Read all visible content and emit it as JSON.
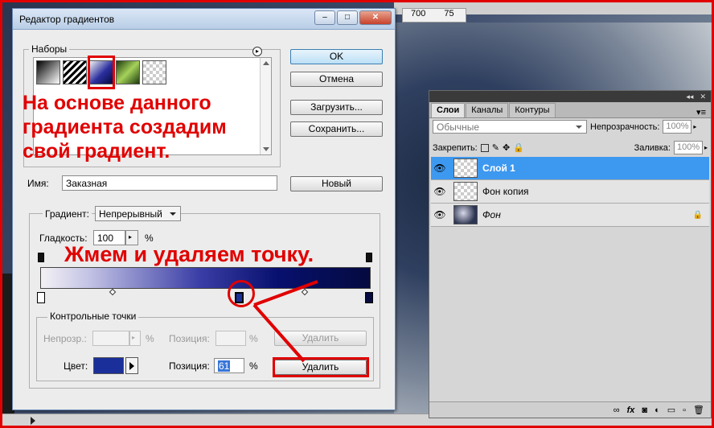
{
  "dialog": {
    "title": "Редактор градиентов",
    "title_buttons": [
      "–",
      "□",
      "✕"
    ],
    "presets_label": "Наборы",
    "presets_menu_icon": "circle-arrow-icon",
    "buttons": {
      "ok": "OK",
      "cancel": "Отмена",
      "load": "Загрузить...",
      "save": "Сохранить...",
      "new": "Новый"
    },
    "name_label": "Имя:",
    "name_value": "Заказная",
    "gradient_type_label": "Градиент:",
    "gradient_type_value": "Непрерывный",
    "smoothness_label": "Гладкость:",
    "smoothness_value": "100",
    "percent": "%",
    "stops_group_label": "Контрольные точки",
    "opacity_label": "Непрозр.:",
    "opacity_position_label": "Позиция:",
    "opacity_delete": "Удалить",
    "color_label": "Цвет:",
    "color_value": "#1a2f9a",
    "color_position_label": "Позиция:",
    "color_position_value": "61",
    "color_delete": "Удалить"
  },
  "annotations": {
    "text1": "На основе данного градиента создадим свой градиент.",
    "text2": "Жмем и удаляем точку.",
    "color": "#e00000"
  },
  "canvas": {
    "ruler_labels": [
      "700",
      "75"
    ]
  },
  "layers_panel": {
    "tabs": [
      "Слои",
      "Каналы",
      "Контуры"
    ],
    "blend_mode": "Обычные",
    "opacity_label": "Непрозрачность:",
    "opacity_value": "100%",
    "lock_label": "Закрепить:",
    "fill_label": "Заливка:",
    "fill_value": "100%",
    "layers": [
      {
        "name": "Слой 1",
        "selected": true
      },
      {
        "name": "Фон копия",
        "selected": false
      },
      {
        "name": "Фон",
        "selected": false
      }
    ],
    "footer_icons": [
      "link-icon",
      "fx-icon",
      "mask-icon",
      "adjustment-icon",
      "group-icon",
      "new-layer-icon",
      "trash-icon"
    ]
  }
}
